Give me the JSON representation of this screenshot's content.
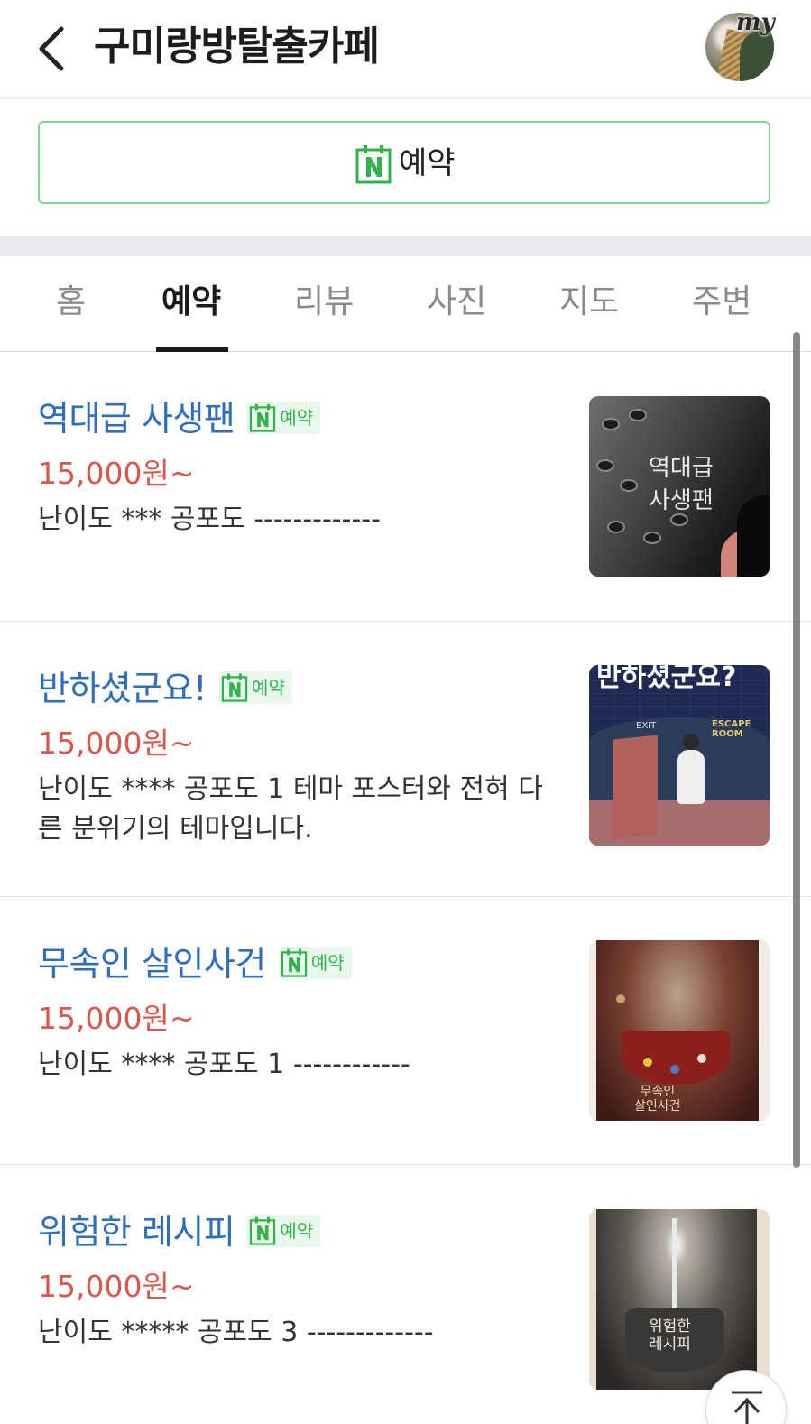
{
  "header": {
    "title": "구미랑방탈출카페",
    "badge": "my"
  },
  "reserve_button": {
    "label": "예약"
  },
  "tabs": [
    {
      "label": "홈",
      "active": false
    },
    {
      "label": "예약",
      "active": true
    },
    {
      "label": "리뷰",
      "active": false
    },
    {
      "label": "사진",
      "active": false
    },
    {
      "label": "지도",
      "active": false
    },
    {
      "label": "주변",
      "active": false
    }
  ],
  "items": [
    {
      "name": "역대급 사생팬",
      "badge": "예약",
      "price": "15,000원~",
      "desc": "난이도 *** 공포도 -------------",
      "thumb_text": [
        "역대급",
        "사생팬"
      ]
    },
    {
      "name": "반하셨군요!",
      "badge": "예약",
      "price": "15,000원~",
      "desc": "난이도 **** 공포도 1 테마 포스터와 전혀 다른 분위기의 테마입니다.",
      "thumb_text": [
        "반하셨군요?",
        "EXIT",
        "ESCAPE ROOM"
      ]
    },
    {
      "name": "무속인 살인사건",
      "badge": "예약",
      "price": "15,000원~",
      "desc": "난이도 **** 공포도 1 ------------",
      "thumb_text": [
        "무속인",
        "살인사건"
      ]
    },
    {
      "name": "위험한 레시피",
      "badge": "예약",
      "price": "15,000원~",
      "desc": "난이도 ***** 공포도 3 -------------",
      "thumb_text": [
        "위험한",
        "레시피"
      ]
    }
  ],
  "colors": {
    "accent_green": "#2fb34a",
    "title_blue": "#2f6ebf",
    "price_red": "#d9584e"
  },
  "icons": [
    "back-arrow-icon",
    "naver-booking-icon",
    "scroll-top-icon"
  ]
}
